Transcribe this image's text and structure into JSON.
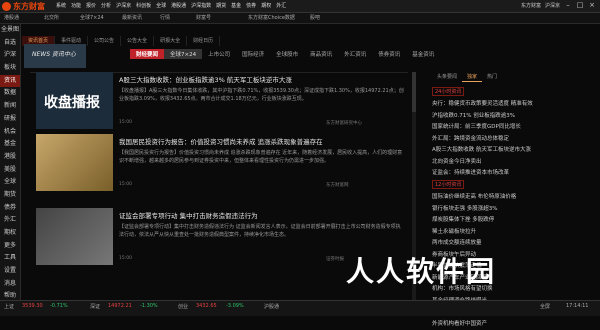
{
  "app": {
    "logo_text": "东方财富",
    "user": "东方财富",
    "dropdown": "沪深京",
    "market": "全球指数"
  },
  "menus": [
    "系统",
    "功能",
    "报价",
    "分析",
    "沪深京",
    "科创板",
    "全球",
    "港股通",
    "沪深指数",
    "期货",
    "基金",
    "债券",
    "期权",
    "外汇",
    "美股",
    "研究报告",
    "数据中心",
    "资讯",
    "全球市场",
    "机构",
    "帮助"
  ],
  "row2": [
    "港股通",
    "北交所",
    "全球7×24",
    "最新资讯",
    "行情",
    "财富号",
    "东方财富Choice数据",
    "股吧"
  ],
  "sidebar": [
    {
      "label": "全景图",
      "active": false
    },
    {
      "label": "自选",
      "active": false
    },
    {
      "label": "沪深",
      "active": false
    },
    {
      "label": "板块",
      "active": false
    },
    {
      "label": "资讯",
      "active": true
    },
    {
      "label": "数据",
      "active": false
    },
    {
      "label": "新闻",
      "active": false
    },
    {
      "label": "研报",
      "active": false
    },
    {
      "label": "机会",
      "active": false
    },
    {
      "label": "基金",
      "active": false
    },
    {
      "label": "港股",
      "active": false
    },
    {
      "label": "美股",
      "active": false
    },
    {
      "label": "全球",
      "active": false
    },
    {
      "label": "期货",
      "active": false
    },
    {
      "label": "债券",
      "active": false
    },
    {
      "label": "外汇",
      "active": false
    },
    {
      "label": "期权",
      "active": false
    },
    {
      "label": "更多",
      "active": false
    },
    {
      "label": "工具",
      "active": false
    },
    {
      "label": "设置",
      "active": false
    },
    {
      "label": "消息",
      "active": false
    },
    {
      "label": "帮助",
      "active": false
    }
  ],
  "tabs1": [
    "资讯首页",
    "事件驱动",
    "公司公告",
    "公告大全",
    "研报大全",
    "财经日历"
  ],
  "banner": "NEWS 资讯中心",
  "newsbar": [
    "财经要闻",
    "全球7×24",
    "上市公司",
    "国际经济",
    "全球股市",
    "商品资讯",
    "外汇资讯",
    "债券资讯",
    "基金资讯"
  ],
  "news": [
    {
      "thumb": "收盘播报",
      "title": "A股三大指数收跌：创业板指跌逾3% 航天军工板块逆市大涨",
      "body": "【收盘播报】A股三大指数今日集体收跌，其中沪指下跌0.71%，收报3539.30点；深证成指下跌1.30%，收报14972.21点；创业板指跌3.09%，收报3432.65点。两市合计成交1.18万亿元，行业板块涨跌互现。",
      "time": "15:00",
      "source": "东方财富研究中心"
    },
    {
      "thumb": "",
      "title": "我国居民投资行为报告：价值投资习惯尚未养成 追涨杀跌现象普遍存在",
      "body": "【我国居民投资行为报告】价值投资习惯尚未养成 追涨杀跌现象普遍存在 近年来，随着经济发展，居民收入提高，人们的理财意识不断增强，越来越多的居民参与到证券投资中来，但整体来看理性投资行为仍需进一步加强。",
      "time": "15:00",
      "source": "东方财富网"
    },
    {
      "thumb": "",
      "title": "证监会部署专项行动 集中打击财务造假违法行为",
      "body": "【证监会部署专项行动】集中打击财务造假违法行为 证监会新闻发言人表示，证监会日前部署开展打击上市公司财务造假专项执法行动，依法从严从快从重查处一批财务造假典型案件，持续净化市场生态。",
      "time": "15:00",
      "source": "证券时报"
    }
  ],
  "rtabs": [
    "头条要闻",
    "独家",
    "热门"
  ],
  "rlabel1": "24小时资讯",
  "rlabel2": "12小时资讯",
  "rlist1": [
    "央行：稳健货币政策要灵活适度 精准有效",
    "沪指收跌0.71% 创业板指跌逾3%",
    "国家统计局：前三季度GDP同比增长",
    "外汇局：跨境资金流动总体稳定",
    "A股三大指数收跌 航天军工板块逆市大涨",
    "北向资金今日净卖出",
    "证监会：持续推进资本市场改革"
  ],
  "rlist2": [
    "国际油价继续走高 布伦特原油价格",
    "银行板块走强 多股涨超3%",
    "煤炭股集体下挫 多股跌停",
    "稀土永磁板块拉升",
    "两市成交额连续放量",
    "券商板块午后异动",
    "半导体板块震荡走低",
    "新能源汽车产业链回调",
    "机构：市场风格有望切换",
    "基金经理调仓路线曝光",
    "本周解禁市值一览",
    "外资机构看好中国资产"
  ],
  "status": {
    "sh_label": "上证",
    "sh_val": "3539.30",
    "sh_chg": "-0.71%",
    "sz_label": "深证",
    "sz_val": "14972.21",
    "sz_chg": "-1.30%",
    "cy_label": "创业",
    "cy_val": "3432.65",
    "cy_chg": "-3.09%",
    "hk_label": "沪股通",
    "time": "17:14:11",
    "status_label": "全屏"
  },
  "watermark": "人人软件园"
}
